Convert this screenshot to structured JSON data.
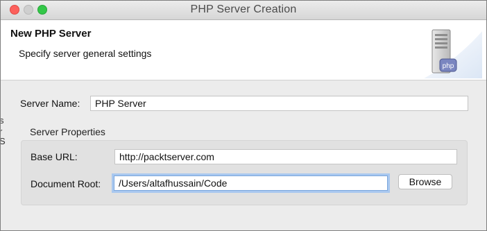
{
  "window": {
    "title": "PHP Server Creation"
  },
  "banner": {
    "title": "New PHP Server",
    "subtitle": "Specify server general settings",
    "icon_label": "php"
  },
  "form": {
    "server_name_label": "Server Name:",
    "server_name_value": "PHP Server",
    "group_title": "Server Properties",
    "base_url_label": "Base URL:",
    "base_url_value": "http://packtserver.com",
    "document_root_label": "Document Root:",
    "document_root_value": "/Users/altafhussain/Code",
    "browse_label": "Browse"
  },
  "icons": [
    "close-icon",
    "minimize-icon",
    "maximize-icon",
    "php-server-icon"
  ],
  "colors": {
    "close": "#fc605c",
    "maximize": "#33c748",
    "focus_ring": "#a9c8ef"
  }
}
